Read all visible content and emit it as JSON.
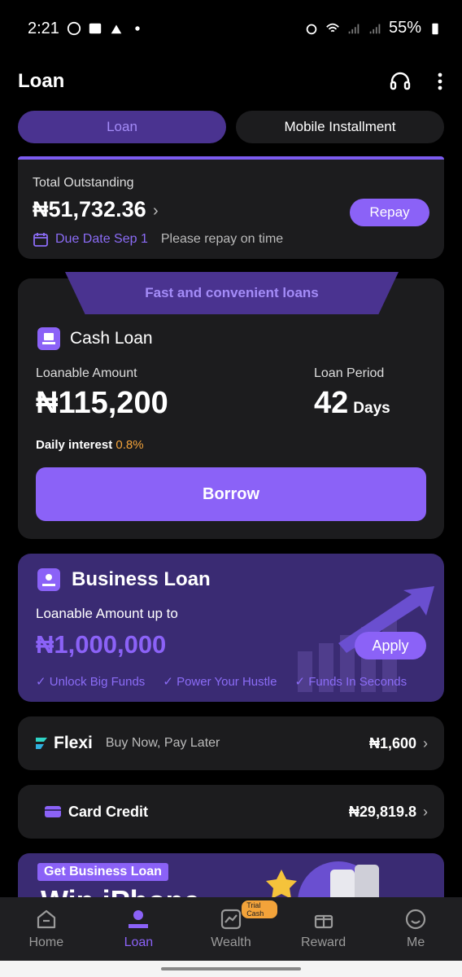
{
  "status_bar": {
    "time": "2:21",
    "battery": "55%"
  },
  "header": {
    "title": "Loan"
  },
  "tabs": [
    {
      "label": "Loan"
    },
    {
      "label": "Mobile Installment"
    }
  ],
  "outstanding": {
    "label": "Total Outstanding",
    "amount": "₦51,732.36",
    "due_date": "Due Date Sep 1",
    "reminder": "Please repay on time",
    "repay_label": "Repay"
  },
  "cash_loan": {
    "banner": "Fast and convenient loans",
    "title": "Cash Loan",
    "loanable_label": "Loanable Amount",
    "loanable_value": "₦115,200",
    "period_label": "Loan Period",
    "period_value": "42",
    "period_unit": "Days",
    "interest_label": "Daily interest ",
    "interest_rate": "0.8%",
    "borrow_label": "Borrow"
  },
  "business_loan": {
    "title": "Business Loan",
    "subtitle": "Loanable Amount up to",
    "amount": "₦1,000,000",
    "apply_label": "Apply",
    "features": [
      "Unlock Big Funds",
      "Power Your Hustle",
      "Funds In Seconds"
    ]
  },
  "flexi": {
    "name": "Flexi",
    "tagline": "Buy Now, Pay Later",
    "amount": "₦1,600"
  },
  "card_credit": {
    "label": "Card Credit",
    "amount": "₦29,819.8"
  },
  "promo": {
    "tag": "Get Business Loan",
    "headline": "Win iPhone"
  },
  "nav": {
    "items": [
      {
        "label": "Home"
      },
      {
        "label": "Loan"
      },
      {
        "label": "Wealth",
        "badge": "Trial Cash"
      },
      {
        "label": "Reward"
      },
      {
        "label": "Me"
      }
    ]
  },
  "colors": {
    "accent": "#8b62f7",
    "accent_dark": "#4a3390",
    "warning": "#f3a33a"
  }
}
